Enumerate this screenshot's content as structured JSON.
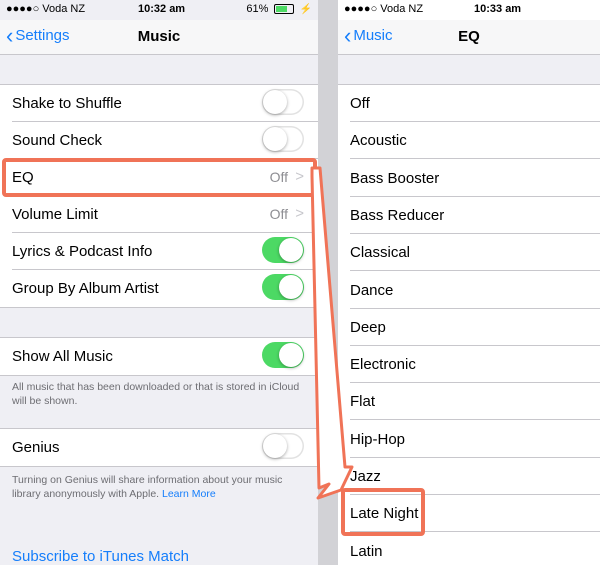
{
  "left": {
    "status": {
      "carrier": "●●●●○ Voda NZ",
      "time": "10:32 am",
      "battery": "61%"
    },
    "nav": {
      "back": "Settings",
      "title": "Music"
    },
    "rows": [
      {
        "label": "Shake to Shuffle"
      },
      {
        "label": "Sound Check"
      },
      {
        "label": "EQ",
        "value": "Off"
      },
      {
        "label": "Volume Limit",
        "value": "Off"
      },
      {
        "label": "Lyrics & Podcast Info"
      },
      {
        "label": "Group By Album Artist"
      }
    ],
    "show_all": {
      "label": "Show All Music",
      "footer": "All music that has been downloaded or that is stored in iCloud will be shown."
    },
    "genius": {
      "label": "Genius",
      "footer": "Turning on Genius will share information about your music library anonymously with Apple.",
      "footer_link": "Learn More"
    },
    "itunes_match": "Subscribe to iTunes Match",
    "switches": {
      "shake": false,
      "sound_check": false,
      "lyrics": true,
      "group_by_album": true,
      "show_all": true,
      "genius": false
    }
  },
  "right": {
    "status": {
      "carrier": "●●●●○ Voda NZ",
      "time": "10:33 am"
    },
    "nav": {
      "back": "Music",
      "title": "EQ"
    },
    "presets": [
      "Off",
      "Acoustic",
      "Bass Booster",
      "Bass Reducer",
      "Classical",
      "Dance",
      "Deep",
      "Electronic",
      "Flat",
      "Hip-Hop",
      "Jazz",
      "Late Night",
      "Latin"
    ]
  },
  "colors": {
    "accent": "#157efb",
    "switch_on": "#4cd964",
    "highlight": "#f07357"
  }
}
